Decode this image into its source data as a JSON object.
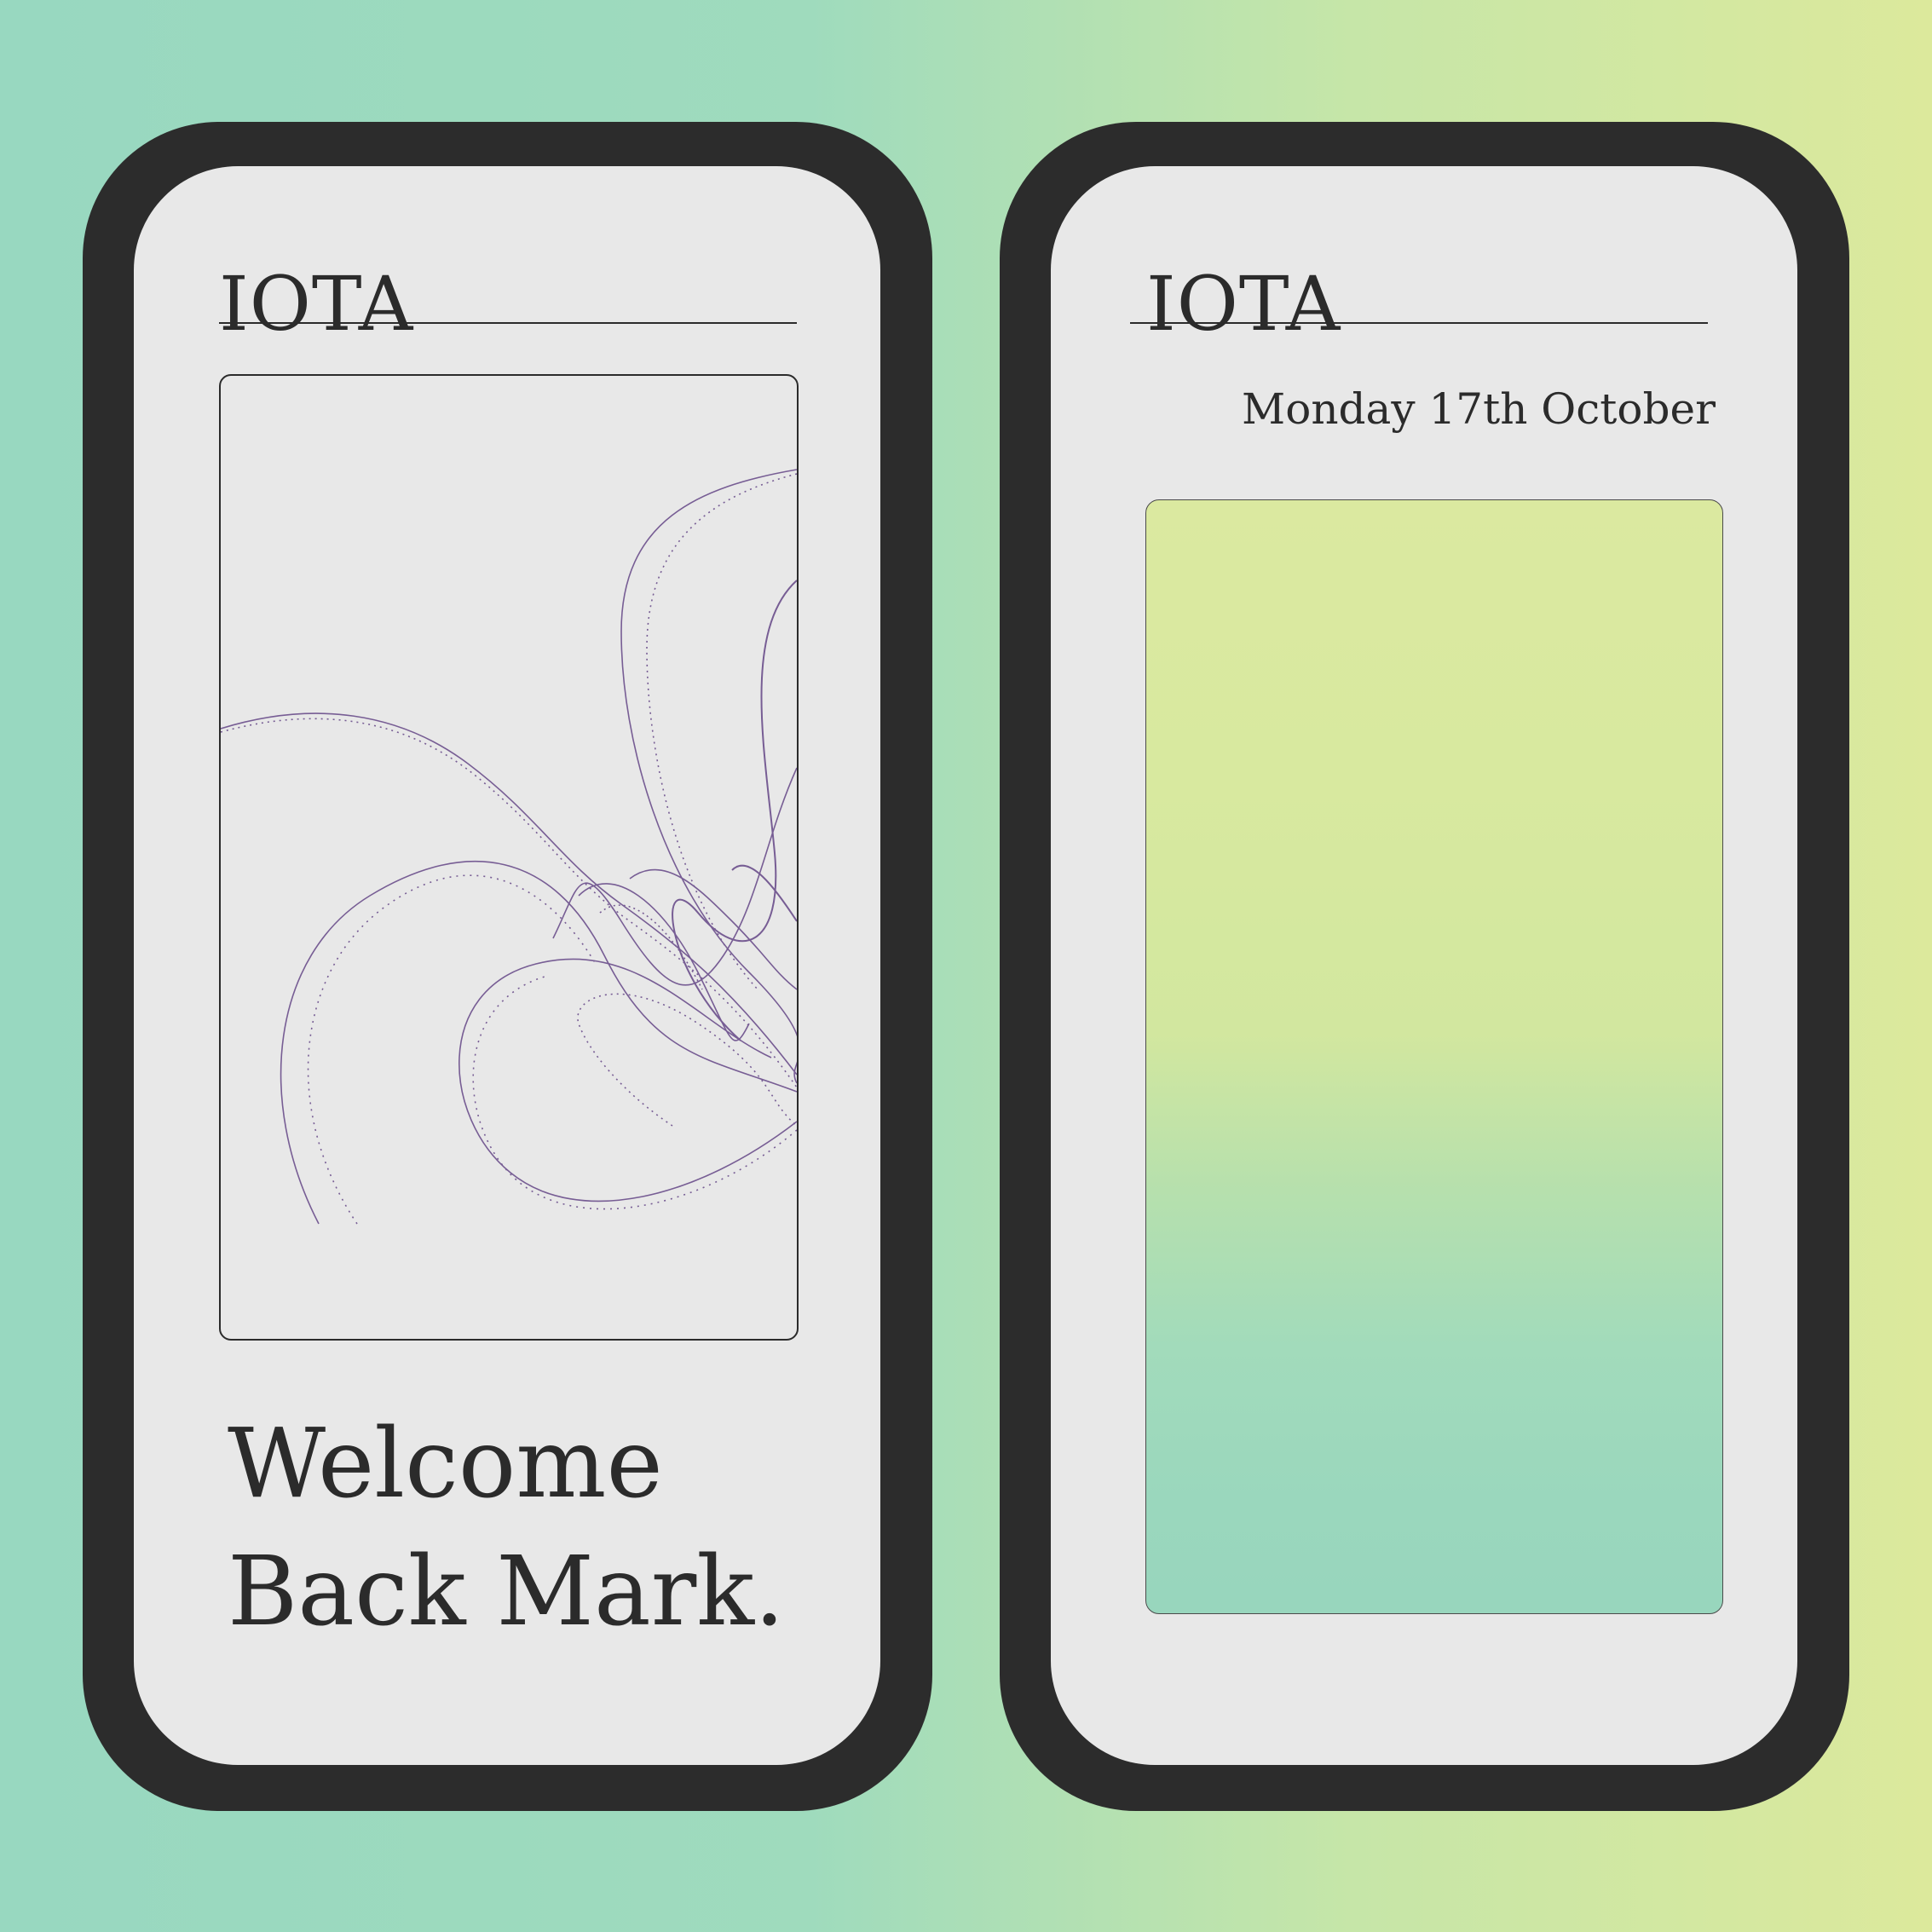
{
  "colors": {
    "background_left": "#98d8c0",
    "background_right": "#dce99c",
    "phone_frame": "#2c2c2c",
    "screen": "#e8e8e8",
    "text": "#2b2b2b",
    "line_art": "#6b4f8c"
  },
  "phones": [
    {
      "title": "IOTA",
      "welcome": {
        "line1": "Welcome",
        "line2": "Back Mark."
      }
    },
    {
      "title": "IOTA",
      "date": "Monday 17th October"
    }
  ]
}
